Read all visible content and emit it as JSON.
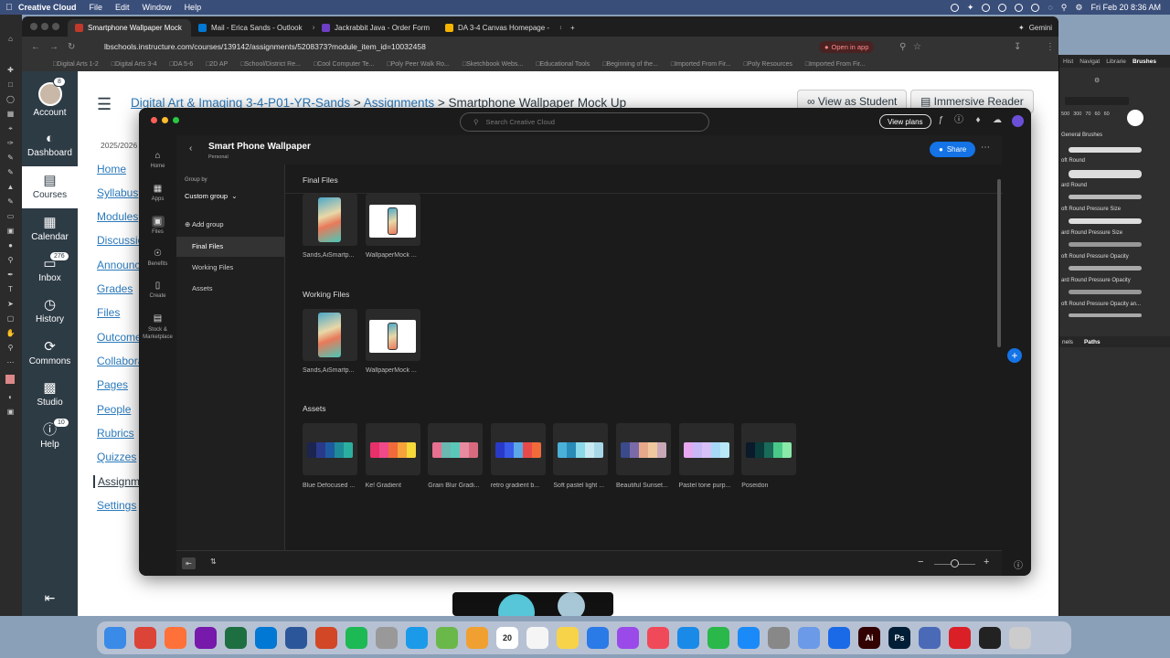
{
  "menubar": {
    "app": "Creative Cloud",
    "items": [
      "File",
      "Edit",
      "Window",
      "Help"
    ],
    "gemini": "Gemini",
    "datetime": "Fri Feb 20  8:36 AM"
  },
  "browser": {
    "tabs": [
      {
        "label": "Smartphone Wallpaper Mock",
        "color": "#c0392b"
      },
      {
        "label": "Mail - Erica Sands - Outlook",
        "color": "#0078d4"
      },
      {
        "label": "Jackrabbit Java - Order Form",
        "color": "#6c3fc4"
      },
      {
        "label": "DA 3-4 Canvas Homepage -",
        "color": "#f4b400"
      }
    ],
    "url": "lbschools.instructure.com/courses/139142/assignments/5208373?module_item_id=10032458",
    "open_in_app": "Open in app",
    "bookmarks": [
      "Digital Arts 1-2",
      "Digital Arts 3-4",
      "DA 5-6",
      "2D AP",
      "School/District Re...",
      "Cool Computer Te...",
      "Poly Peer Walk Ro...",
      "Sketchbook Webs...",
      "Educational Tools",
      "Beginning of the...",
      "Imported From Fir...",
      "Poly Resources",
      "Imported From Fir..."
    ]
  },
  "canvas": {
    "nav": [
      {
        "label": "Account",
        "icon": "avatar-icon",
        "badge": "8"
      },
      {
        "label": "Dashboard",
        "icon": "dashboard-icon"
      },
      {
        "label": "Courses",
        "icon": "courses-icon",
        "active": true
      },
      {
        "label": "Calendar",
        "icon": "calendar-icon"
      },
      {
        "label": "Inbox",
        "icon": "inbox-icon",
        "badge": "276"
      },
      {
        "label": "History",
        "icon": "history-icon"
      },
      {
        "label": "Commons",
        "icon": "commons-icon"
      },
      {
        "label": "Studio",
        "icon": "studio-icon"
      },
      {
        "label": "Help",
        "icon": "help-icon",
        "badge": "10"
      }
    ],
    "breadcrumb": {
      "course": "Digital Art & Imaging 3-4-P01-YR-Sands",
      "sep": ">",
      "section": "Assignments",
      "page": "Smartphone Wallpaper Mock Up"
    },
    "view_as_student": "View as Student",
    "immersive_reader": "Immersive Reader",
    "term": "2025/2026",
    "course_links": [
      "Home",
      "Syllabus",
      "Modules",
      "Discussio",
      "Announc",
      "Grades",
      "Files",
      "Outcome",
      "Collabora",
      "Pages",
      "People",
      "Rubrics",
      "Quizzes",
      "Assignm",
      "Settings"
    ]
  },
  "photoshop": {
    "tabs": [
      "Hist",
      "Navigat",
      "Librarie",
      "Brushes"
    ],
    "brush_sizes": [
      "500",
      "300",
      "70",
      "60",
      "60"
    ],
    "folder": "General Brushes",
    "brushes": [
      "oft Round",
      "ard Round",
      "oft Round Pressure Size",
      "ard Round Pressure Size",
      "oft Round Pressure Opacity",
      "ard Round Pressure Opacity",
      "oft Round Pressure Opacity an..."
    ],
    "bottom_tabs": [
      "nels",
      "Paths"
    ]
  },
  "cc": {
    "search_placeholder": "Search Creative Cloud",
    "view_plans": "View plans",
    "rail": [
      {
        "label": "Home",
        "icon": "home-icon"
      },
      {
        "label": "Apps",
        "icon": "apps-icon"
      },
      {
        "label": "Files",
        "icon": "files-icon",
        "active": true
      },
      {
        "label": "Benefits",
        "icon": "benefits-icon"
      },
      {
        "label": "Create",
        "icon": "create-icon"
      },
      {
        "label": "Stock & Marketplace",
        "icon": "stock-icon"
      }
    ],
    "project_title": "Smart Phone Wallpaper",
    "project_subtitle": "Personal",
    "share": "Share",
    "group_by_label": "Group by",
    "group_by_value": "Custom group",
    "add_group": "Add group",
    "groups": [
      "Final Files",
      "Working Files",
      "Assets"
    ],
    "sections": {
      "final": {
        "title": "Final Files",
        "files": [
          {
            "name": "Sands,AiSmartp...",
            "kind": "art"
          },
          {
            "name": "WallpaperMock ...",
            "kind": "mock"
          }
        ]
      },
      "working": {
        "title": "Working Files",
        "files": [
          {
            "name": "Sands,AiSmartp...",
            "kind": "art"
          },
          {
            "name": "WallpaperMock ...",
            "kind": "mock"
          }
        ]
      },
      "assets": {
        "title": "Assets",
        "items": [
          {
            "name": "Blue Defocused ...",
            "colors": [
              "#1c2450",
              "#2a3a8a",
              "#1e5aa0",
              "#1f8a9a",
              "#2bb0a0"
            ]
          },
          {
            "name": "Ke! Gradient",
            "colors": [
              "#e8306a",
              "#f04a8a",
              "#f26a3a",
              "#f7a23a",
              "#f7d93a"
            ]
          },
          {
            "name": "Grain Blur Gradi...",
            "colors": [
              "#e87090",
              "#6ab8b0",
              "#5ac8b8",
              "#e88aa0",
              "#d86a80"
            ]
          },
          {
            "name": "retro gradient b...",
            "colors": [
              "#2a3ac8",
              "#3a5ae8",
              "#5aa8e8",
              "#e84a4a",
              "#f06a3a"
            ]
          },
          {
            "name": "Soft pastel light ...",
            "colors": [
              "#4ab0d8",
              "#2a8ab8",
              "#8ad8e8",
              "#c8eaf0",
              "#a8d8e8"
            ]
          },
          {
            "name": "Beautiful Sunset...",
            "colors": [
              "#3a4a8a",
              "#7a6aa8",
              "#e8a88a",
              "#f0c8a0",
              "#c8a8b8"
            ]
          },
          {
            "name": "Pastel tone purp...",
            "colors": [
              "#e8a8f0",
              "#c8b8f8",
              "#d8c0f8",
              "#a8d8f8",
              "#b8e8f8"
            ]
          },
          {
            "name": "Poseidon",
            "colors": [
              "#0a1a2a",
              "#0a3a3a",
              "#1a6a5a",
              "#4ac88a",
              "#8ae8a8"
            ]
          }
        ]
      }
    }
  },
  "dock": {
    "apps": [
      {
        "name": "Finder",
        "color": "#3a8ae8"
      },
      {
        "name": "Chrome",
        "color": "#db4437"
      },
      {
        "name": "Firefox",
        "color": "#ff7139"
      },
      {
        "name": "OneNote",
        "color": "#7719aa"
      },
      {
        "name": "Excel",
        "color": "#1d6f42"
      },
      {
        "name": "Outlook",
        "color": "#0078d4"
      },
      {
        "name": "Word",
        "color": "#2b579a"
      },
      {
        "name": "PowerPoint",
        "color": "#d24726"
      },
      {
        "name": "Spotify",
        "color": "#1db954"
      },
      {
        "name": "Launchpad",
        "color": "#999999"
      },
      {
        "name": "Safari",
        "color": "#1a9ae8"
      },
      {
        "name": "Maps",
        "color": "#6ab84a"
      },
      {
        "name": "Photos",
        "color": "#f0a030"
      },
      {
        "name": "Calendar",
        "color": "#ffffff",
        "text": "20"
      },
      {
        "name": "Reminders",
        "color": "#f5f5f5"
      },
      {
        "name": "Notes",
        "color": "#f7d34a"
      },
      {
        "name": "Freeform",
        "color": "#2a7ae8"
      },
      {
        "name": "Podcasts",
        "color": "#9a4ae8"
      },
      {
        "name": "News",
        "color": "#f04a5a"
      },
      {
        "name": "Keynote",
        "color": "#1a8ae8"
      },
      {
        "name": "Numbers",
        "color": "#2ab84a"
      },
      {
        "name": "App Store",
        "color": "#1a8af8"
      },
      {
        "name": "System Settings",
        "color": "#888888"
      },
      {
        "name": "Preview",
        "color": "#6a9ae8"
      },
      {
        "name": "Xcode",
        "color": "#1a6ae8"
      },
      {
        "name": "Illustrator",
        "color": "#330000",
        "text": "Ai"
      },
      {
        "name": "Photoshop",
        "color": "#001e36",
        "text": "Ps"
      },
      {
        "name": "Screen Sharing",
        "color": "#4a6ab8"
      },
      {
        "name": "Creative Cloud",
        "color": "#da1f26"
      },
      {
        "name": "Terminal",
        "color": "#222222"
      },
      {
        "name": "Trash",
        "color": "#cccccc"
      }
    ]
  }
}
